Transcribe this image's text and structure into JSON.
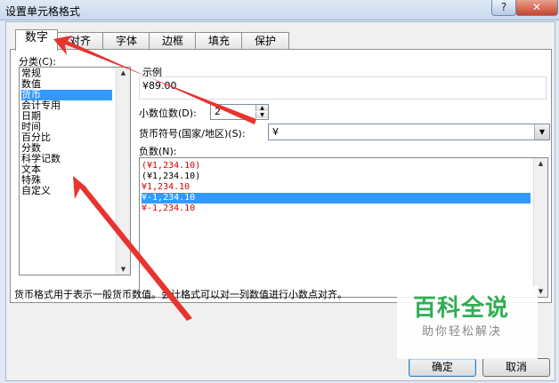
{
  "window": {
    "title": "设置单元格格式",
    "help_glyph": "?",
    "close_glyph": "✕"
  },
  "tabs": [
    {
      "label": "数字",
      "active": true
    },
    {
      "label": "对齐"
    },
    {
      "label": "字体"
    },
    {
      "label": "边框"
    },
    {
      "label": "填充"
    },
    {
      "label": "保护"
    }
  ],
  "category": {
    "label": "分类(C):",
    "items": [
      "常规",
      "数值",
      "货币",
      "会计专用",
      "日期",
      "时间",
      "百分比",
      "分数",
      "科学记数",
      "文本",
      "特殊",
      "自定义"
    ],
    "selected_index": 2
  },
  "sample": {
    "label": "示例",
    "value": "¥89.00"
  },
  "decimal": {
    "label": "小数位数(D):",
    "value": "2"
  },
  "currency_symbol": {
    "label": "货币符号(国家/地区)(S):",
    "value": "¥"
  },
  "negative": {
    "label": "负数(N):",
    "items": [
      {
        "text": "(¥1,234.10)",
        "color": "#e00000"
      },
      {
        "text": "(¥1,234.10)",
        "color": "#000000"
      },
      {
        "text": "¥1,234.10",
        "color": "#e00000"
      },
      {
        "text": "¥-1,234.10",
        "color": "#000000"
      },
      {
        "text": "¥-1,234.10",
        "color": "#e00000"
      }
    ],
    "selected_index": 3
  },
  "description": "货币格式用于表示一般货币数值。会计格式可以对一列数值进行小数点对齐。",
  "buttons": {
    "ok": "确定",
    "cancel": "取消"
  },
  "watermark": {
    "line1": "百科全说",
    "line2": "助你轻松解决"
  },
  "colors": {
    "selection": "#3399ff",
    "annotation_arrow": "#e8342f",
    "negative_red": "#e00000",
    "watermark_green": "#2fae53"
  }
}
